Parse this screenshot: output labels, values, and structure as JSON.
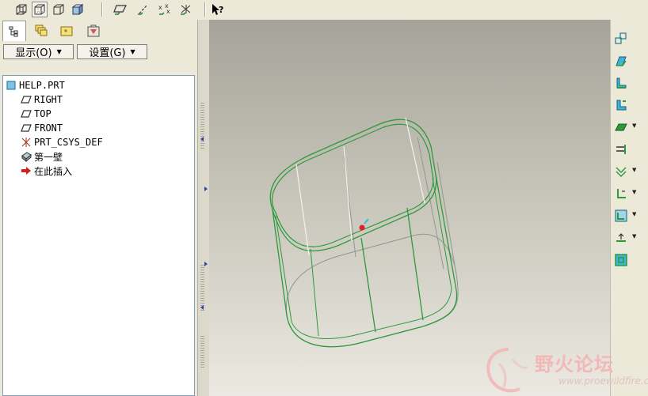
{
  "toolbar": {
    "icons": [
      "display-style-wireframe-icon",
      "display-style-hidden-line-icon",
      "display-style-no-hidden-icon",
      "display-style-shaded-icon",
      "datum-planes-toggle-icon",
      "datum-axes-toggle-icon",
      "datum-points-toggle-icon",
      "coordinate-systems-toggle-icon",
      "context-help-icon"
    ]
  },
  "left_panel": {
    "tabs": [
      "model-tree-tab",
      "layer-tree-tab",
      "folder-browser-tab",
      "favorites-tab"
    ],
    "show_menu": "显示(O)",
    "settings_menu": "设置(G)",
    "tree": [
      {
        "label": "HELP.PRT",
        "icon": "part-icon"
      },
      {
        "label": "RIGHT",
        "icon": "datum-plane-icon"
      },
      {
        "label": "TOP",
        "icon": "datum-plane-icon"
      },
      {
        "label": "FRONT",
        "icon": "datum-plane-icon"
      },
      {
        "label": "PRT_CSYS_DEF",
        "icon": "csys-icon"
      },
      {
        "label": "第一壁",
        "icon": "first-wall-feature-icon"
      },
      {
        "label": "在此插入",
        "icon": "insert-here-arrow-icon"
      }
    ]
  },
  "right_toolbar": {
    "icons": [
      "sheetmetal-convert-icon",
      "flat-wall-icon",
      "flange-wall-icon",
      "unattached-wall-icon",
      "extend-wall-icon",
      "rip-icon",
      "merge-icon",
      "bend-icon",
      "unbend-icon",
      "bend-back-icon",
      "flat-pattern-icon"
    ]
  },
  "watermark": {
    "text": "野火论坛",
    "url": "www.proewildfire.cn"
  },
  "colors": {
    "model_edge": "#2e9a3c",
    "hidden_edge": "#8f9a8f",
    "selection_point": "#e0202a",
    "pick_marker": "#20c8d8"
  }
}
